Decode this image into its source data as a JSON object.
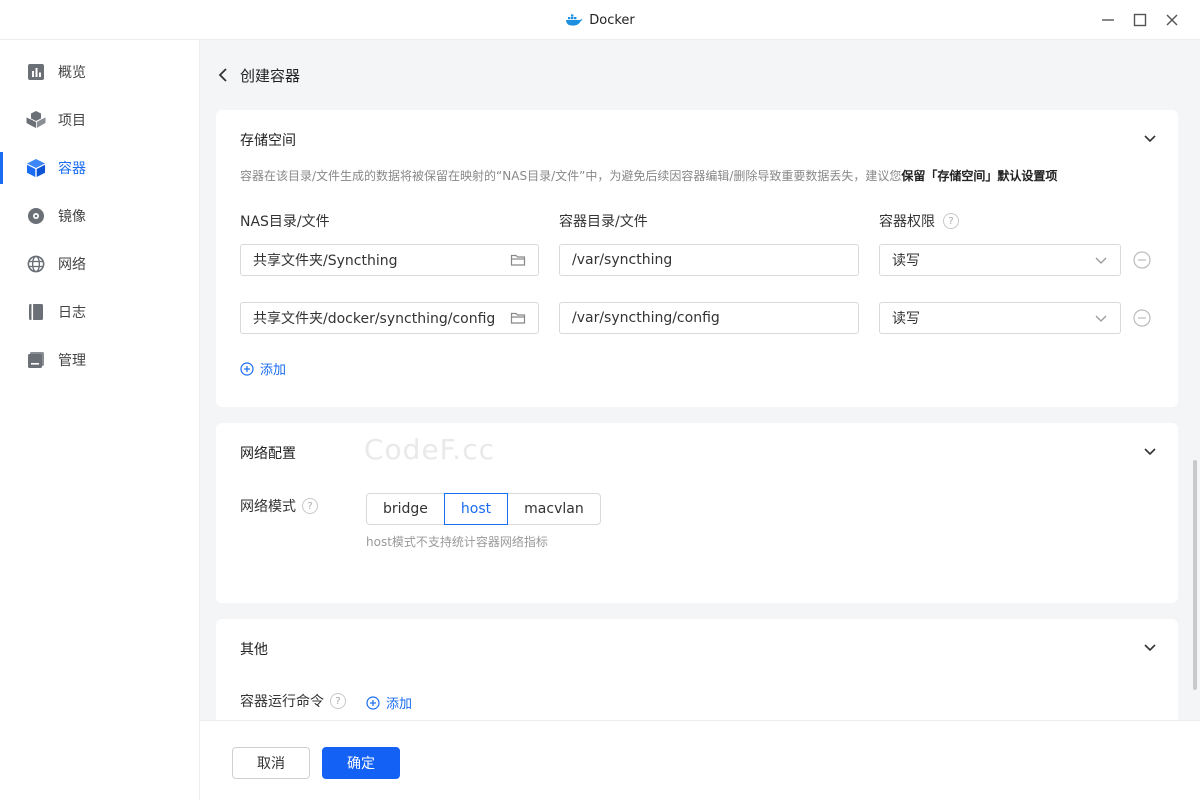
{
  "window": {
    "title": "Docker",
    "icon": "docker-whale-icon",
    "controls": [
      "minimize-icon",
      "maximize-icon",
      "close-icon"
    ]
  },
  "sidebar": {
    "items": [
      {
        "label": "概览",
        "icon": "overview-icon"
      },
      {
        "label": "项目",
        "icon": "project-icon"
      },
      {
        "label": "容器",
        "icon": "container-icon",
        "active": true
      },
      {
        "label": "镜像",
        "icon": "image-icon"
      },
      {
        "label": "网络",
        "icon": "network-icon"
      },
      {
        "label": "日志",
        "icon": "log-icon"
      },
      {
        "label": "管理",
        "icon": "manage-icon"
      }
    ]
  },
  "page": {
    "title": "创建容器"
  },
  "storage": {
    "title": "存储空间",
    "hint_prefix": "容器在该目录/文件生成的数据将被保留在映射的“NAS目录/文件”中，为避免后续因容器编辑/删除导致重要数据丢失，建议您",
    "hint_bold": "保留「存储空间」默认设置项",
    "columns": {
      "nas": "NAS目录/文件",
      "container": "容器目录/文件",
      "permission": "容器权限"
    },
    "rows": [
      {
        "nas": "共享文件夹/Syncthing",
        "container": "/var/syncthing",
        "permission": "读写"
      },
      {
        "nas": "共享文件夹/docker/syncthing/config",
        "container": "/var/syncthing/config",
        "permission": "读写"
      }
    ],
    "add_label": "添加"
  },
  "network": {
    "title": "网络配置",
    "watermark": "CodeF.cc",
    "mode_label": "网络模式",
    "modes": [
      "bridge",
      "host",
      "macvlan"
    ],
    "selected_mode": "host",
    "mode_hint": "host模式不支持统计容器网络指标"
  },
  "other": {
    "title": "其他",
    "command_label": "容器运行命令",
    "add_label": "添加"
  },
  "footer": {
    "cancel": "取消",
    "confirm": "确定"
  },
  "colors": {
    "accent": "#1a6cf0",
    "primary_button": "#1462f5",
    "background": "#f4f5f7"
  }
}
